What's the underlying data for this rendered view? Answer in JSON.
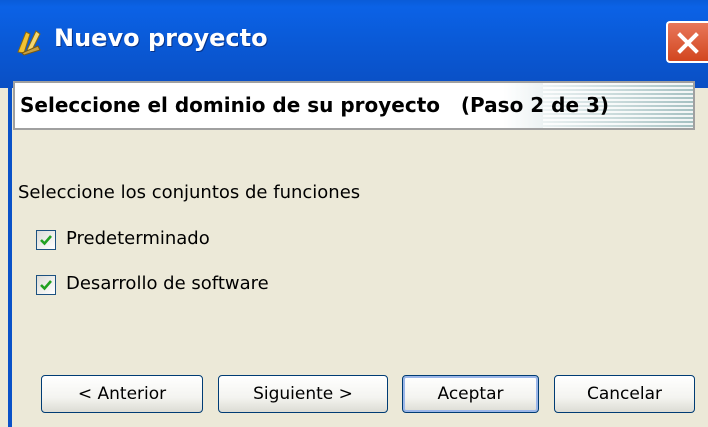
{
  "window": {
    "title": "Nuevo proyecto",
    "close_icon": "close-icon"
  },
  "header": {
    "text": "Seleccione el dominio de su proyecto   (Paso 2 de 3)"
  },
  "section": {
    "label": "Seleccione los conjuntos de funciones"
  },
  "options": [
    {
      "label": "Predeterminado",
      "checked": true
    },
    {
      "label": "Desarrollo de software",
      "checked": true
    }
  ],
  "buttons": {
    "previous": "< Anterior",
    "next": "Siguiente >",
    "accept": "Aceptar",
    "cancel": "Cancelar"
  },
  "colors": {
    "titlebar": "#0a58d4",
    "close": "#d2461f",
    "checkmark": "#21a121",
    "background": "#ece9d8"
  }
}
